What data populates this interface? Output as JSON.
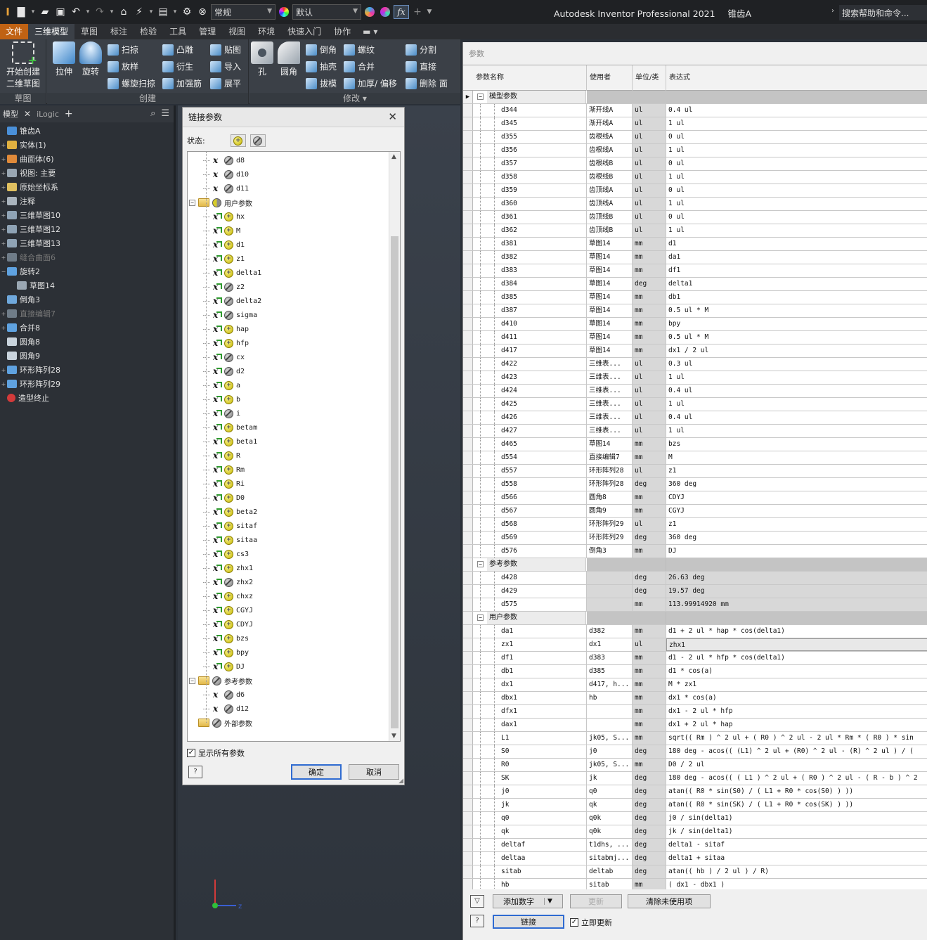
{
  "quick_access": {
    "style_combo": "常规",
    "appearance_combo": "默认",
    "fx_icon": "fx"
  },
  "app_title": "Autodesk Inventor Professional 2021",
  "doc_name": "锥齿A",
  "help_search": "搜索帮助和命令...",
  "tabs": [
    "文件",
    "三维模型",
    "草图",
    "标注",
    "检验",
    "工具",
    "管理",
    "视图",
    "环境",
    "快速入门",
    "协作"
  ],
  "ribbon": {
    "sketch_group": {
      "title": "草图",
      "start_label_1": "开始创建",
      "start_label_2": "二维草图"
    },
    "create_group": {
      "title": "创建",
      "extrude": "拉伸",
      "revolve": "旋转",
      "sweep": "扫掠",
      "loft": "放样",
      "coil": "螺旋扫掠",
      "emboss": "凸雕",
      "derive": "衍生",
      "rib": "加强筋",
      "decal": "贴图",
      "import": "导入",
      "unfold": "展平"
    },
    "modify_group": {
      "title": "修改",
      "hole": "孔",
      "fillet": "圆角",
      "chamfer": "倒角",
      "shell": "抽壳",
      "draft": "拔模",
      "thread": "螺纹",
      "combine": "合并",
      "thicken": "加厚/ 偏移",
      "split": "分割",
      "direct": "直接",
      "delete_face": "删除 面"
    }
  },
  "browser": {
    "tab_model": "模型",
    "tab_ilogic": "iLogic",
    "items": [
      {
        "label": "锥齿A",
        "indent": 0,
        "dim": false
      },
      {
        "label": "实体(1)",
        "indent": 1,
        "dim": false
      },
      {
        "label": "曲面体(6)",
        "indent": 1,
        "dim": false
      },
      {
        "label": "视图: 主要",
        "indent": 1,
        "dim": false
      },
      {
        "label": "原始坐标系",
        "indent": 1,
        "dim": false
      },
      {
        "label": "注释",
        "indent": 1,
        "dim": false
      },
      {
        "label": "三维草图10",
        "indent": 1,
        "dim": false
      },
      {
        "label": "三维草图12",
        "indent": 1,
        "dim": false
      },
      {
        "label": "三维草图13",
        "indent": 1,
        "dim": false
      },
      {
        "label": "缝合曲面6",
        "indent": 1,
        "dim": true
      },
      {
        "label": "旋转2",
        "indent": 1,
        "dim": false
      },
      {
        "label": "草图14",
        "indent": 2,
        "dim": false
      },
      {
        "label": "倒角3",
        "indent": 1,
        "dim": false
      },
      {
        "label": "直接编辑7",
        "indent": 1,
        "dim": true
      },
      {
        "label": "合并8",
        "indent": 1,
        "dim": false
      },
      {
        "label": "圆角8",
        "indent": 1,
        "dim": false
      },
      {
        "label": "圆角9",
        "indent": 1,
        "dim": false
      },
      {
        "label": "环形阵列28",
        "indent": 1,
        "dim": false
      },
      {
        "label": "环形阵列29",
        "indent": 1,
        "dim": false
      },
      {
        "label": "造型终止",
        "indent": 1,
        "dim": false
      }
    ]
  },
  "link_dialog": {
    "title": "链接参数",
    "status_label": "状态:",
    "rows": [
      {
        "type": "param",
        "kind": "x",
        "dot": "grey",
        "label": "d8"
      },
      {
        "type": "param",
        "kind": "x",
        "dot": "grey",
        "label": "d10"
      },
      {
        "type": "param",
        "kind": "x",
        "dot": "grey",
        "label": "d11"
      },
      {
        "type": "group",
        "dot": "half",
        "label": "用户参数"
      },
      {
        "type": "param",
        "kind": "xe",
        "dot": "yellow",
        "label": "hx"
      },
      {
        "type": "param",
        "kind": "xe",
        "dot": "yellow",
        "label": "M"
      },
      {
        "type": "param",
        "kind": "xe",
        "dot": "yellow",
        "label": "d1"
      },
      {
        "type": "param",
        "kind": "xe",
        "dot": "yellow",
        "label": "z1"
      },
      {
        "type": "param",
        "kind": "xe",
        "dot": "yellow",
        "label": "delta1"
      },
      {
        "type": "param",
        "kind": "xe",
        "dot": "grey",
        "label": "z2"
      },
      {
        "type": "param",
        "kind": "xe",
        "dot": "grey",
        "label": "delta2"
      },
      {
        "type": "param",
        "kind": "xe",
        "dot": "grey",
        "label": "sigma"
      },
      {
        "type": "param",
        "kind": "xe",
        "dot": "yellow",
        "label": "hap"
      },
      {
        "type": "param",
        "kind": "xe",
        "dot": "yellow",
        "label": "hfp"
      },
      {
        "type": "param",
        "kind": "xe",
        "dot": "grey",
        "label": "cx"
      },
      {
        "type": "param",
        "kind": "xe",
        "dot": "grey",
        "label": "d2"
      },
      {
        "type": "param",
        "kind": "xe",
        "dot": "yellow",
        "label": "a"
      },
      {
        "type": "param",
        "kind": "xe",
        "dot": "yellow",
        "label": "b"
      },
      {
        "type": "param",
        "kind": "xe",
        "dot": "grey",
        "label": "i"
      },
      {
        "type": "param",
        "kind": "xe",
        "dot": "yellow",
        "label": "betam"
      },
      {
        "type": "param",
        "kind": "xe",
        "dot": "yellow",
        "label": "beta1"
      },
      {
        "type": "param",
        "kind": "xe",
        "dot": "yellow",
        "label": "R"
      },
      {
        "type": "param",
        "kind": "xe",
        "dot": "yellow",
        "label": "Rm"
      },
      {
        "type": "param",
        "kind": "xe",
        "dot": "yellow",
        "label": "Ri"
      },
      {
        "type": "param",
        "kind": "xe",
        "dot": "yellow",
        "label": "D0"
      },
      {
        "type": "param",
        "kind": "xe",
        "dot": "yellow",
        "label": "beta2"
      },
      {
        "type": "param",
        "kind": "xe",
        "dot": "yellow",
        "label": "sitaf"
      },
      {
        "type": "param",
        "kind": "xe",
        "dot": "yellow",
        "label": "sitaa"
      },
      {
        "type": "param",
        "kind": "xe",
        "dot": "yellow",
        "label": "cs3"
      },
      {
        "type": "param",
        "kind": "xe",
        "dot": "yellow",
        "label": "zhx1"
      },
      {
        "type": "param",
        "kind": "xe",
        "dot": "grey",
        "label": "zhx2"
      },
      {
        "type": "param",
        "kind": "xe",
        "dot": "yellow",
        "label": "chxz"
      },
      {
        "type": "param",
        "kind": "xe",
        "dot": "yellow",
        "label": "CGYJ"
      },
      {
        "type": "param",
        "kind": "xe",
        "dot": "yellow",
        "label": "CDYJ"
      },
      {
        "type": "param",
        "kind": "xe",
        "dot": "yellow",
        "label": "bzs"
      },
      {
        "type": "param",
        "kind": "xe",
        "dot": "yellow",
        "label": "bpy"
      },
      {
        "type": "param",
        "kind": "xe",
        "dot": "yellow",
        "label": "DJ"
      },
      {
        "type": "group",
        "dot": "grey",
        "label": "参考参数"
      },
      {
        "type": "param",
        "kind": "x",
        "dot": "grey",
        "label": "d6"
      },
      {
        "type": "param",
        "kind": "x",
        "dot": "grey",
        "label": "d12"
      },
      {
        "type": "group",
        "dot": "grey",
        "label": "外部参数"
      }
    ],
    "show_all_label": "显示所有参数",
    "ok_label": "确定",
    "cancel_label": "取消",
    "help_label": "?"
  },
  "params_dialog": {
    "title": "参数",
    "columns": [
      "参数名称",
      "使用者",
      "单位/类",
      "表达式"
    ],
    "groups": [
      {
        "label": "模型参数",
        "rows": [
          [
            "d344",
            "渐开线A",
            "ul",
            "0.4 ul"
          ],
          [
            "d345",
            "渐开线A",
            "ul",
            "1 ul"
          ],
          [
            "d355",
            "齿根线A",
            "ul",
            "0 ul"
          ],
          [
            "d356",
            "齿根线A",
            "ul",
            "1 ul"
          ],
          [
            "d357",
            "齿根线B",
            "ul",
            "0 ul"
          ],
          [
            "d358",
            "齿根线B",
            "ul",
            "1 ul"
          ],
          [
            "d359",
            "齿顶线A",
            "ul",
            "0 ul"
          ],
          [
            "d360",
            "齿顶线A",
            "ul",
            "1 ul"
          ],
          [
            "d361",
            "齿顶线B",
            "ul",
            "0 ul"
          ],
          [
            "d362",
            "齿顶线B",
            "ul",
            "1 ul"
          ],
          [
            "d381",
            "草图14",
            "mm",
            "d1"
          ],
          [
            "d382",
            "草图14",
            "mm",
            "da1"
          ],
          [
            "d383",
            "草图14",
            "mm",
            "df1"
          ],
          [
            "d384",
            "草图14",
            "deg",
            "delta1"
          ],
          [
            "d385",
            "草图14",
            "mm",
            "db1"
          ],
          [
            "d387",
            "草图14",
            "mm",
            "0.5 ul * M"
          ],
          [
            "d410",
            "草图14",
            "mm",
            "bpy"
          ],
          [
            "d411",
            "草图14",
            "mm",
            "0.5 ul * M"
          ],
          [
            "d417",
            "草图14",
            "mm",
            "dx1 / 2 ul"
          ],
          [
            "d422",
            "三维表...",
            "ul",
            "0.3 ul"
          ],
          [
            "d423",
            "三维表...",
            "ul",
            "1 ul"
          ],
          [
            "d424",
            "三维表...",
            "ul",
            "0.4 ul"
          ],
          [
            "d425",
            "三维表...",
            "ul",
            "1 ul"
          ],
          [
            "d426",
            "三维表...",
            "ul",
            "0.4 ul"
          ],
          [
            "d427",
            "三维表...",
            "ul",
            "1 ul"
          ],
          [
            "d465",
            "草图14",
            "mm",
            "bzs"
          ],
          [
            "d554",
            "直接编辑7",
            "mm",
            "M"
          ],
          [
            "d557",
            "环形阵列28",
            "ul",
            "z1"
          ],
          [
            "d558",
            "环形阵列28",
            "deg",
            "360 deg"
          ],
          [
            "d566",
            "圆角8",
            "mm",
            "CDYJ"
          ],
          [
            "d567",
            "圆角9",
            "mm",
            "CGYJ"
          ],
          [
            "d568",
            "环形阵列29",
            "ul",
            "z1"
          ],
          [
            "d569",
            "环形阵列29",
            "deg",
            "360 deg"
          ],
          [
            "d576",
            "倒角3",
            "mm",
            "DJ"
          ]
        ]
      },
      {
        "label": "参考参数",
        "rows": [
          [
            "d428",
            "",
            "deg",
            "26.63 deg"
          ],
          [
            "d429",
            "",
            "deg",
            "19.57 deg"
          ],
          [
            "d575",
            "",
            "mm",
            "113.99914920 mm"
          ]
        ]
      },
      {
        "label": "用户参数",
        "rows": [
          [
            "da1",
            "d382",
            "mm",
            "d1 + 2 ul * hap * cos(delta1)"
          ],
          [
            "zx1",
            "dx1",
            "ul",
            "zhx1"
          ],
          [
            "df1",
            "d383",
            "mm",
            "d1 - 2 ul * hfp * cos(delta1)"
          ],
          [
            "db1",
            "d385",
            "mm",
            "d1 * cos(a)"
          ],
          [
            "dx1",
            "d417, h...",
            "mm",
            "M * zx1"
          ],
          [
            "dbx1",
            "hb",
            "mm",
            "dx1 * cos(a)"
          ],
          [
            "dfx1",
            "",
            "mm",
            "dx1 - 2 ul * hfp"
          ],
          [
            "dax1",
            "",
            "mm",
            "dx1 + 2 ul * hap"
          ],
          [
            "L1",
            "jk05, S...",
            "mm",
            "sqrt(( Rm ) ^ 2 ul + ( R0 ) ^ 2 ul - 2 ul * Rm * ( R0 ) * sin"
          ],
          [
            "S0",
            "j0",
            "deg",
            "180 deg - acos(( (L1) ^ 2 ul + (R0) ^ 2 ul - (R) ^ 2 ul ) / ("
          ],
          [
            "R0",
            "jk05, S...",
            "mm",
            "D0 / 2 ul"
          ],
          [
            "SK",
            "jk",
            "deg",
            "180 deg - acos(( ( L1 ) ^ 2 ul + ( R0 ) ^ 2 ul - ( R - b ) ^ 2"
          ],
          [
            "j0",
            "q0",
            "deg",
            "atan(( R0 * sin(S0) / ( L1 + R0 * cos(S0) ) ))"
          ],
          [
            "jk",
            "qk",
            "deg",
            "atan(( R0 * sin(SK) / ( L1 + R0 * cos(SK) ) ))"
          ],
          [
            "q0",
            "q0k",
            "deg",
            "j0 / sin(delta1)"
          ],
          [
            "qk",
            "q0k",
            "deg",
            "jk / sin(delta1)"
          ],
          [
            "deltaf",
            "t1dhs, ...",
            "deg",
            "delta1 - sitaf"
          ],
          [
            "deltaa",
            "sitabmj...",
            "deg",
            "delta1 + sitaa"
          ],
          [
            "sitab",
            "deltab",
            "deg",
            "atan(( hb ) / 2 ul ) / R)"
          ],
          [
            "hb",
            "sitab",
            "mm",
            "( dx1 - dbx1 )"
          ]
        ]
      }
    ],
    "add_numeric": "添加数字",
    "update": "更新",
    "purge": "清除未使用项",
    "link": "链接",
    "immediate_update": "立即更新",
    "help_label": "?"
  }
}
